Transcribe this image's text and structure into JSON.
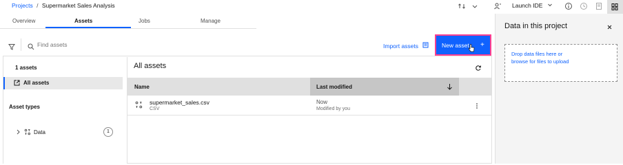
{
  "breadcrumb": {
    "projects_label": "Projects",
    "separator": "/",
    "project_name": "Supermarket Sales Analysis"
  },
  "header": {
    "launch_ide_label": "Launch IDE"
  },
  "tabs": [
    {
      "label": "Overview"
    },
    {
      "label": "Assets"
    },
    {
      "label": "Jobs"
    },
    {
      "label": "Manage"
    }
  ],
  "toolbar": {
    "search_placeholder": "Find assets",
    "import_assets_label": "Import assets",
    "new_asset_label": "New asset",
    "new_asset_plus": "+"
  },
  "sidebar": {
    "count_label": "1 assets",
    "all_assets_label": "All assets",
    "asset_types_heading": "Asset types",
    "data_label": "Data",
    "data_count": "1"
  },
  "main": {
    "heading": "All assets",
    "columns": {
      "name": "Name",
      "last_modified": "Last modified"
    },
    "rows": [
      {
        "name": "supermarket_sales.csv",
        "type": "CSV",
        "modified": "Now",
        "modified_by": "Modified by you"
      }
    ]
  },
  "right_panel": {
    "title": "Data in this project",
    "drop_line1": "Drop data files here or",
    "drop_line2": "browse for files to upload"
  },
  "colors": {
    "accent": "#0f62fe",
    "highlight_border": "#ff3f8f"
  }
}
